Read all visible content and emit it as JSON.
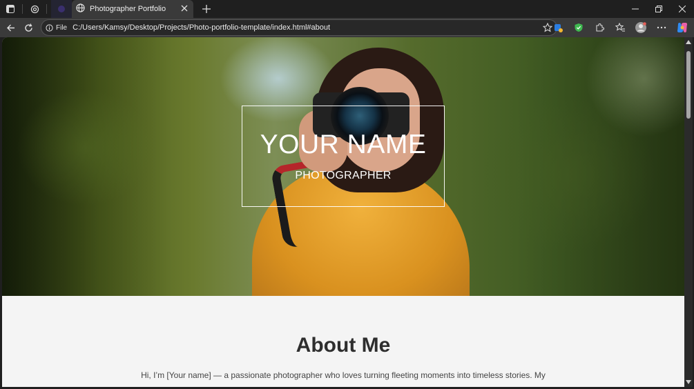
{
  "browser": {
    "tab": {
      "title": "Photographer Portfolio",
      "favicon": "globe-icon"
    },
    "address_bar": {
      "site_info_label": "File",
      "url": "C:/Users/Kamsy/Desktop/Projects/Photo-portfolio-template/index.html#about"
    },
    "icons": {
      "tab_actions": "tab-actions-icon",
      "workspaces": "workspaces-icon",
      "back": "back-arrow-icon",
      "refresh": "refresh-icon",
      "favorite": "star-icon",
      "extensions": "puzzle-icon",
      "collections": "favorites-icon",
      "profile": "profile-icon",
      "more": "more-icon",
      "copilot": "copilot-icon"
    }
  },
  "page": {
    "hero": {
      "name": "YOUR NAME",
      "role": "PHOTOGRAPHER"
    },
    "about": {
      "title": "About Me",
      "text": "Hi, I’m [Your name] — a passionate photographer who loves turning fleeting moments into timeless stories. My"
    }
  }
}
